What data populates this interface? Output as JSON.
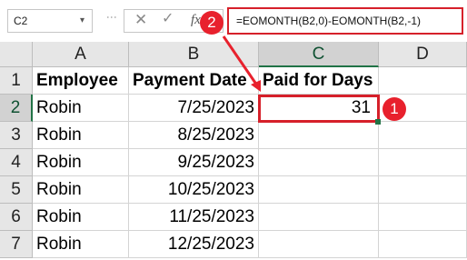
{
  "name_box": {
    "value": "C2"
  },
  "formula_bar": {
    "fx_label": "fx",
    "formula": "=EOMONTH(B2,0)-EOMONTH(B2,-1)"
  },
  "annotations": {
    "badge1": "1",
    "badge2": "2"
  },
  "columns": [
    "A",
    "B",
    "C",
    "D"
  ],
  "rows": [
    "1",
    "2",
    "3",
    "4",
    "5",
    "6",
    "7"
  ],
  "sheet": {
    "headers": {
      "a": "Employee",
      "b": "Payment Date",
      "c": "Paid for Days"
    },
    "data": [
      {
        "employee": "Robin",
        "payment_date": "7/25/2023",
        "paid_days": "31"
      },
      {
        "employee": "Robin",
        "payment_date": "8/25/2023",
        "paid_days": ""
      },
      {
        "employee": "Robin",
        "payment_date": "9/25/2023",
        "paid_days": ""
      },
      {
        "employee": "Robin",
        "payment_date": "10/25/2023",
        "paid_days": ""
      },
      {
        "employee": "Robin",
        "payment_date": "11/25/2023",
        "paid_days": ""
      },
      {
        "employee": "Robin",
        "payment_date": "12/25/2023",
        "paid_days": ""
      }
    ]
  },
  "colors": {
    "highlight": "#e8212d",
    "selection": "#217346"
  }
}
